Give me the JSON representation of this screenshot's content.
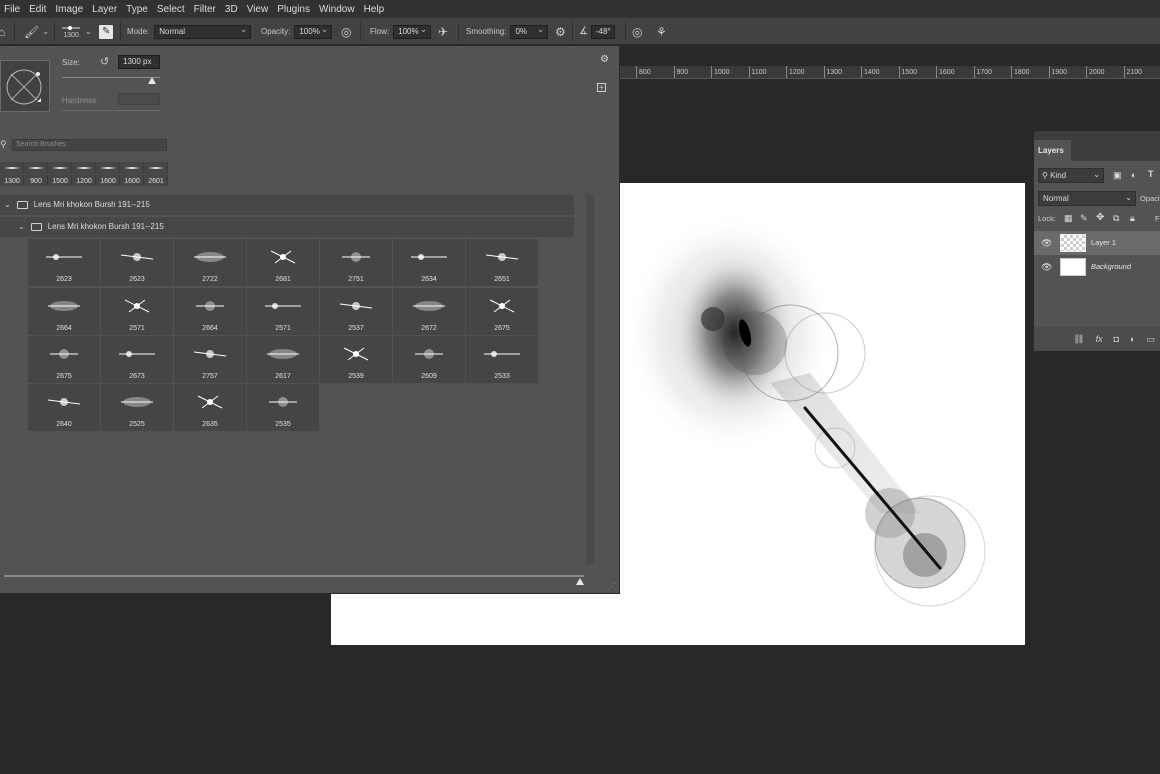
{
  "menu": [
    "File",
    "Edit",
    "Image",
    "Layer",
    "Type",
    "Select",
    "Filter",
    "3D",
    "View",
    "Plugins",
    "Window",
    "Help"
  ],
  "options": {
    "brush_size": "1300",
    "mode_label": "Mode:",
    "mode_value": "Normal",
    "opacity_label": "Opacity:",
    "opacity_value": "100%",
    "flow_label": "Flow:",
    "flow_value": "100%",
    "smoothing_label": "Smoothing:",
    "smoothing_value": "0%",
    "angle_value": "-48°"
  },
  "ruler_ticks": [
    "800",
    "900",
    "1000",
    "1100",
    "1200",
    "1300",
    "1400",
    "1500",
    "1600",
    "1700",
    "1800",
    "1900",
    "2000",
    "2100"
  ],
  "brush_panel": {
    "size_label": "Size:",
    "size_value": "1300 px",
    "hardness_label": "Hardness:",
    "search_placeholder": "Search Brushes",
    "recent": [
      "1300",
      "900",
      "1500",
      "1200",
      "1600",
      "1600",
      "2601"
    ],
    "group_outer": "Lens Mri khokon Bursh 191--215",
    "group_inner": "Lens Mri khokon Bursh 191--215",
    "brushes": [
      [
        "2623",
        "2623",
        "2722",
        "2681",
        "2751",
        "2634",
        "2651"
      ],
      [
        "2664",
        "2571",
        "2664",
        "2571",
        "2537",
        "2672",
        "2675"
      ],
      [
        "2675",
        "2673",
        "2757",
        "2617",
        "2539",
        "2609",
        "2533"
      ],
      [
        "2640",
        "2525",
        "2635",
        "2535"
      ]
    ]
  },
  "layers": {
    "tab": "Layers",
    "filter_kind": "Kind",
    "blend_mode": "Normal",
    "opacity_label": "Opacit",
    "lock_label": "Lock:",
    "items": [
      {
        "name": "Layer 1"
      },
      {
        "name": "Background"
      }
    ]
  },
  "colors": {
    "ui_dark": "#282828",
    "panel": "#535353",
    "canvas": "#ffffff"
  }
}
